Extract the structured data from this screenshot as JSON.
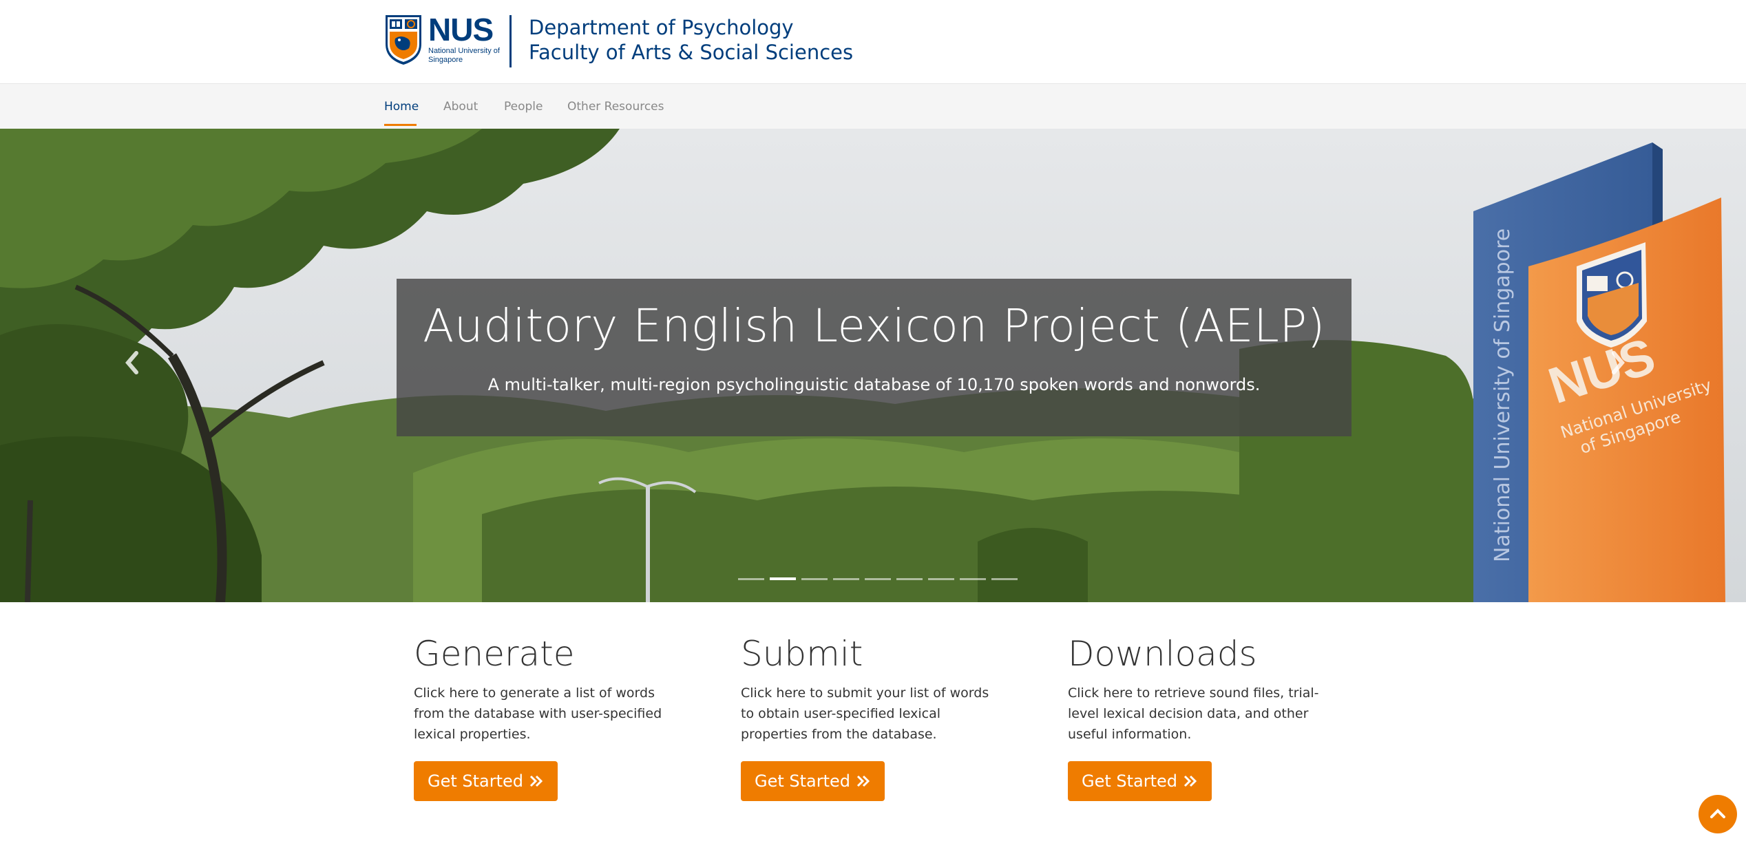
{
  "header": {
    "logo_text": "NUS",
    "logo_subtext": "National University of Singapore",
    "dept_line1": "Department of Psychology",
    "dept_line2": "Faculty of Arts & Social Sciences"
  },
  "nav": {
    "items": [
      {
        "label": "Home",
        "active": true
      },
      {
        "label": "About",
        "active": false
      },
      {
        "label": "People",
        "active": false
      },
      {
        "label": "Other Resources",
        "active": false
      }
    ]
  },
  "hero": {
    "title": "Auditory English Lexicon Project (AELP)",
    "subtitle": "A multi-talker, multi-region psycholinguistic database of 10,170 spoken words and nonwords.",
    "slide_count": 9,
    "active_slide": 2,
    "sign_vertical_text": "National University of Singapore",
    "sign_logo": "NUS",
    "sign_subtext": "National University of Singapore"
  },
  "features": [
    {
      "title": "Generate",
      "text": "Click here to generate a list of words from the database with user-specified lexical properties.",
      "button": "Get Started"
    },
    {
      "title": "Submit",
      "text": "Click here to submit your list of words to obtain user-specified lexical properties from the database.",
      "button": "Get Started"
    },
    {
      "title": "Downloads",
      "text": "Click here to retrieve sound files, trial-level lexical decision data, and other useful information.",
      "button": "Get Started"
    }
  ],
  "colors": {
    "nus_blue": "#003d7c",
    "nus_orange": "#ef7c00",
    "nav_bg": "#f5f5f5"
  },
  "icons": {
    "carousel_prev": "chevron-left-icon",
    "carousel_next": "chevron-right-icon",
    "button_icon": "double-chevron-right-icon",
    "back_to_top": "chevron-up-icon"
  }
}
